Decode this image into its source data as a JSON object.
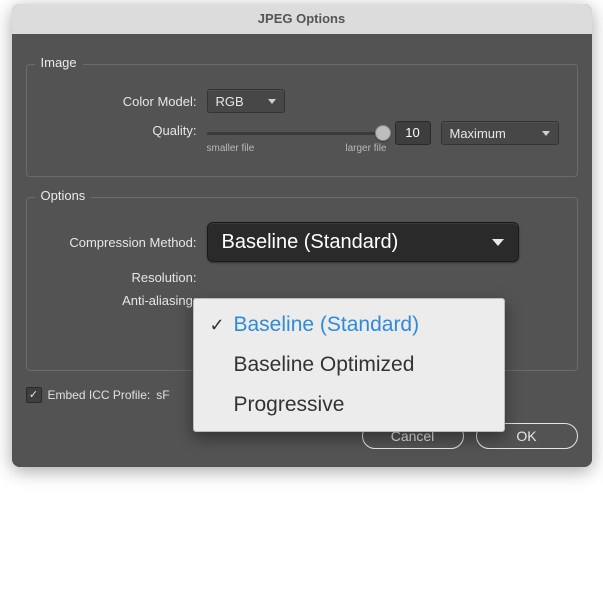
{
  "title": "JPEG Options",
  "image": {
    "legend": "Image",
    "colorModelLabel": "Color Model:",
    "colorModelValue": "RGB",
    "qualityLabel": "Quality:",
    "sliderLow": "smaller file",
    "sliderHigh": "larger file",
    "qualityValue": "10",
    "qualityPreset": "Maximum"
  },
  "options": {
    "legend": "Options",
    "compressionLabel": "Compression Method:",
    "compressionValue": "Baseline (Standard)",
    "resolutionLabel": "Resolution:",
    "antiAliasingLabel": "Anti-aliasing:",
    "dropdown": {
      "items": [
        {
          "label": "Baseline (Standard)",
          "selected": true
        },
        {
          "label": "Baseline Optimized",
          "selected": false
        },
        {
          "label": "Progressive",
          "selected": false
        }
      ]
    }
  },
  "embed": {
    "checked": true,
    "label": "Embed ICC Profile:",
    "profile": "sF"
  },
  "buttons": {
    "cancel": "Cancel",
    "ok": "OK"
  }
}
